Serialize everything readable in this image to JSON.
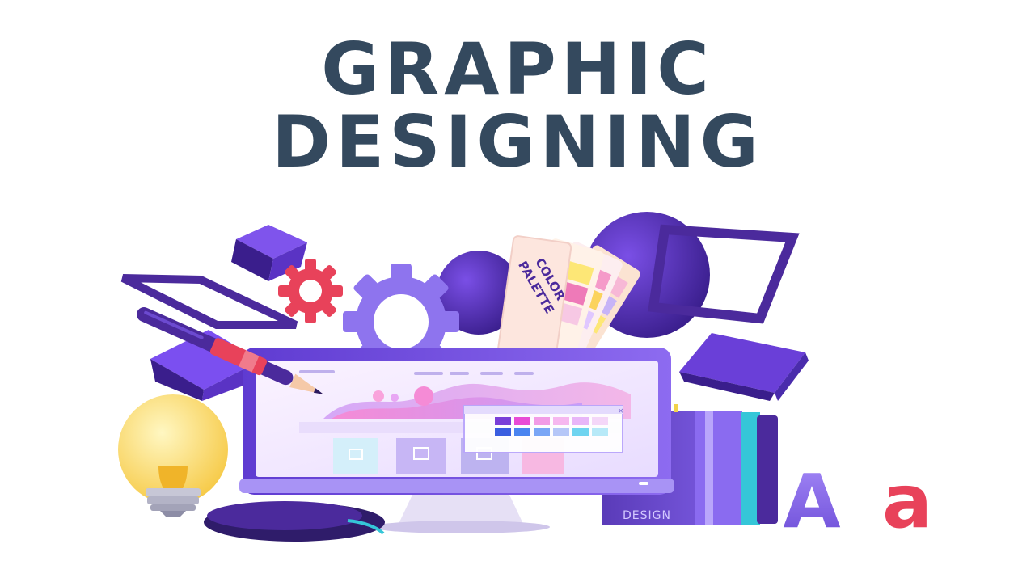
{
  "title": {
    "line1": "GRAPHIC",
    "line2": "DESIGNING"
  },
  "palette": {
    "label_line1": "COLOR",
    "label_line2": "PALETTE"
  },
  "book": {
    "label": "DESIGN"
  },
  "font_sample": {
    "upper": "A",
    "lower": "a"
  },
  "colors": {
    "title": "#34495e",
    "purple_dark": "#4b2a9c",
    "purple": "#6a3fd8",
    "violet": "#8e6cf5",
    "pink": "#e94b8b",
    "red": "#e8425a",
    "yellow": "#fde776",
    "teal": "#35c6d8",
    "background": "#ffffff"
  }
}
